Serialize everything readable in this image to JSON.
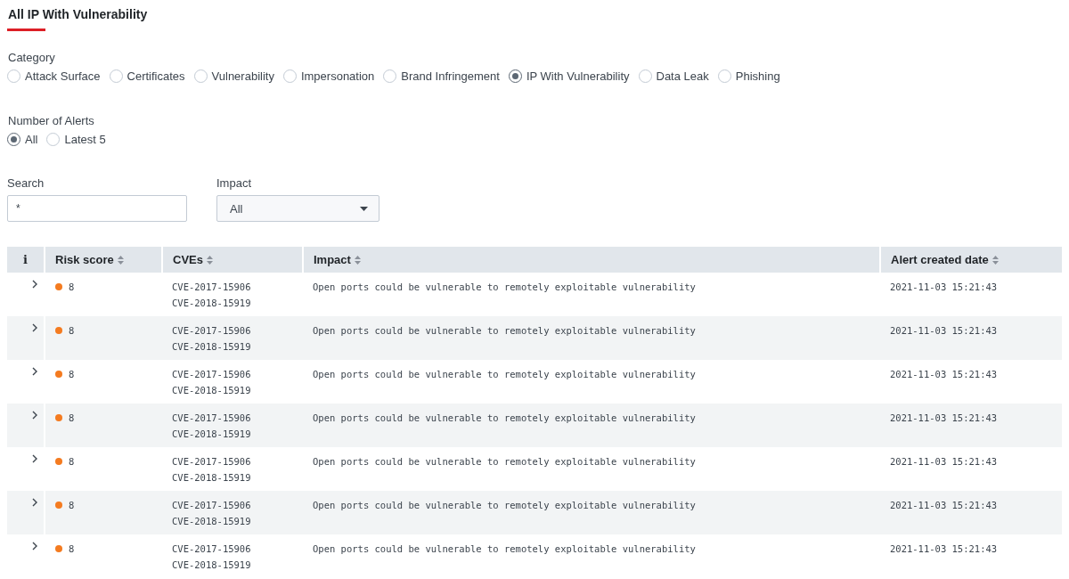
{
  "title": "All IP With Vulnerability",
  "category": {
    "label": "Category",
    "options": [
      {
        "label": "Attack Surface",
        "selected": false
      },
      {
        "label": "Certificates",
        "selected": false
      },
      {
        "label": "Vulnerability",
        "selected": false
      },
      {
        "label": "Impersonation",
        "selected": false
      },
      {
        "label": "Brand Infringement",
        "selected": false
      },
      {
        "label": "IP With Vulnerability",
        "selected": true
      },
      {
        "label": "Data Leak",
        "selected": false
      },
      {
        "label": "Phishing",
        "selected": false
      }
    ]
  },
  "alerts": {
    "label": "Number of Alerts",
    "options": [
      {
        "label": "All",
        "selected": true
      },
      {
        "label": "Latest 5",
        "selected": false
      }
    ]
  },
  "search": {
    "label": "Search",
    "value": "*"
  },
  "impact_filter": {
    "label": "Impact",
    "value": "All"
  },
  "table": {
    "columns": [
      "i",
      "Risk score",
      "CVEs",
      "Impact",
      "Alert created date"
    ],
    "rows": [
      {
        "risk_score": "8",
        "color": "#f47b20",
        "cves": [
          "CVE-2017-15906",
          "CVE-2018-15919"
        ],
        "impact": "Open ports could be vulnerable to remotely exploitable vulnerability",
        "date": "2021-11-03 15:21:43"
      },
      {
        "risk_score": "8",
        "color": "#f47b20",
        "cves": [
          "CVE-2017-15906",
          "CVE-2018-15919"
        ],
        "impact": "Open ports could be vulnerable to remotely exploitable vulnerability",
        "date": "2021-11-03 15:21:43"
      },
      {
        "risk_score": "8",
        "color": "#f47b20",
        "cves": [
          "CVE-2017-15906",
          "CVE-2018-15919"
        ],
        "impact": "Open ports could be vulnerable to remotely exploitable vulnerability",
        "date": "2021-11-03 15:21:43"
      },
      {
        "risk_score": "8",
        "color": "#f47b20",
        "cves": [
          "CVE-2017-15906",
          "CVE-2018-15919"
        ],
        "impact": "Open ports could be vulnerable to remotely exploitable vulnerability",
        "date": "2021-11-03 15:21:43"
      },
      {
        "risk_score": "8",
        "color": "#f47b20",
        "cves": [
          "CVE-2017-15906",
          "CVE-2018-15919"
        ],
        "impact": "Open ports could be vulnerable to remotely exploitable vulnerability",
        "date": "2021-11-03 15:21:43"
      },
      {
        "risk_score": "8",
        "color": "#f47b20",
        "cves": [
          "CVE-2017-15906",
          "CVE-2018-15919"
        ],
        "impact": "Open ports could be vulnerable to remotely exploitable vulnerability",
        "date": "2021-11-03 15:21:43"
      },
      {
        "risk_score": "8",
        "color": "#f47b20",
        "cves": [
          "CVE-2017-15906",
          "CVE-2018-15919"
        ],
        "impact": "Open ports could be vulnerable to remotely exploitable vulnerability",
        "date": "2021-11-03 15:21:43"
      }
    ]
  }
}
